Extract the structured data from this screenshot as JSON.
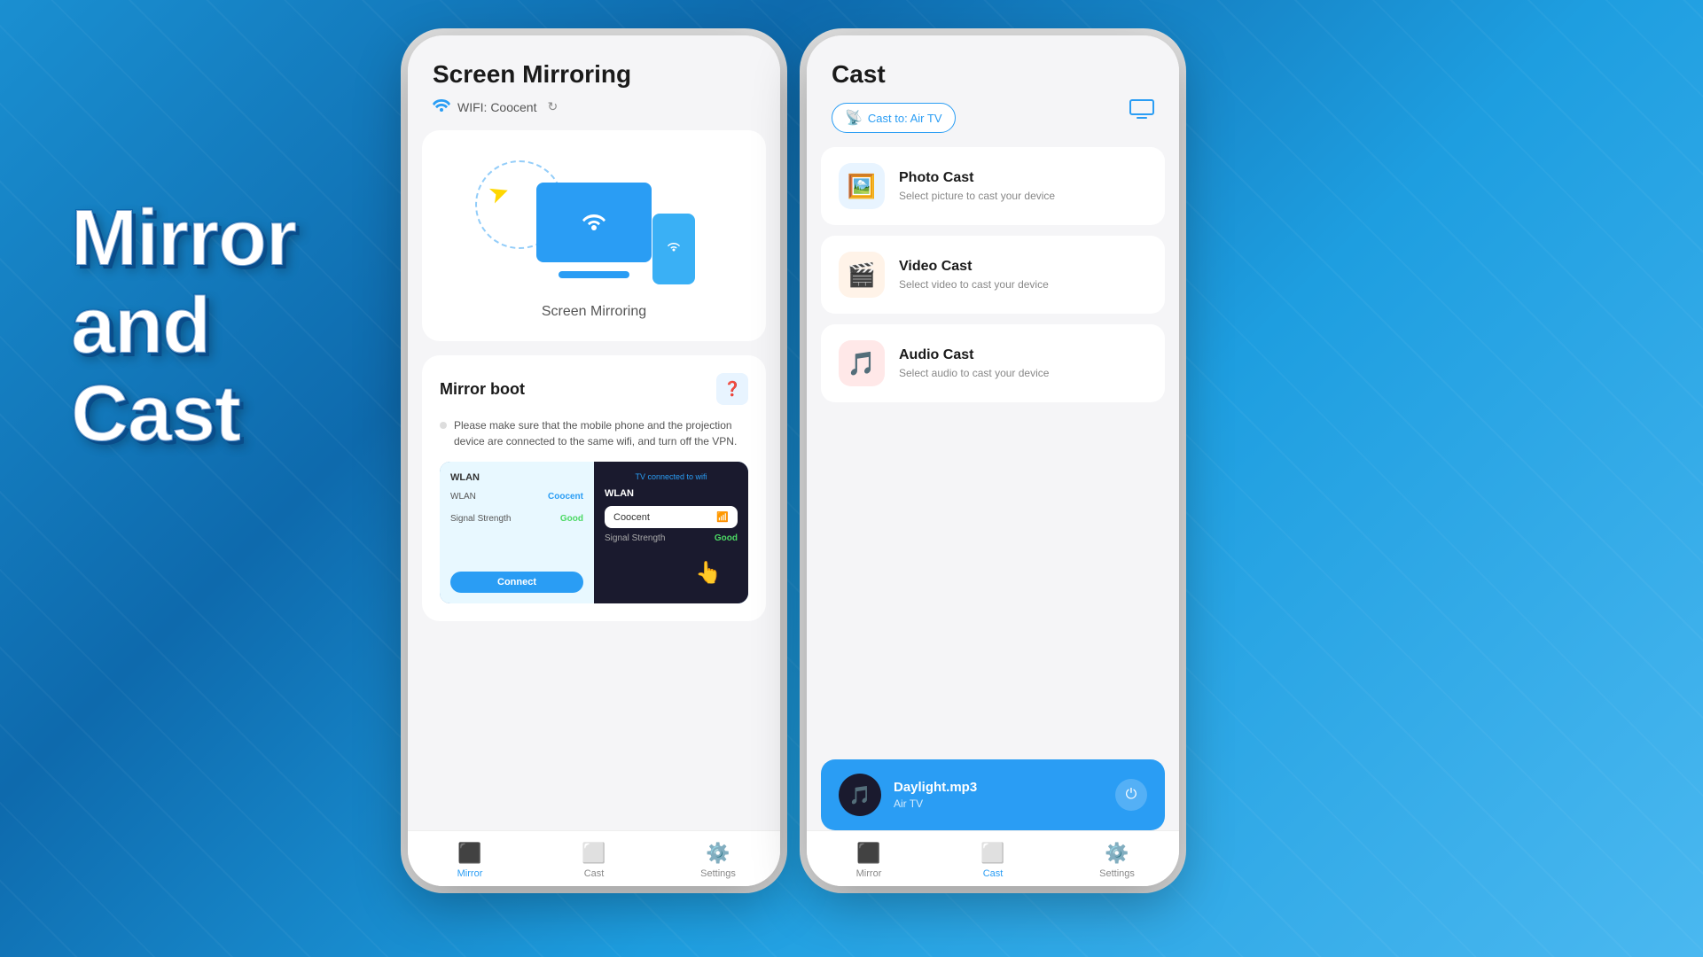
{
  "background": {
    "gradient_start": "#1a8fd1",
    "gradient_end": "#4ab8f0"
  },
  "hero": {
    "line1": "Mirror",
    "line2": "and",
    "line3": "Cast"
  },
  "mirror_screen": {
    "title": "Screen Mirroring",
    "wifi_label": "WIFI: Coocent",
    "mirror_label": "Screen Mirroring",
    "mirror_boot_title": "Mirror boot",
    "instruction": "Please make sure that the mobile phone and the projection device are connected to the same wifi, and turn off the VPN.",
    "tutorial_wlan": "WLAN",
    "tutorial_network": "Coocent",
    "tutorial_signal_label": "Signal Strength",
    "tutorial_signal_value": "Good",
    "tutorial_connect": "Connect",
    "tutorial_tv_connected": "TV connected to wifi",
    "nav_mirror_label": "Mirror",
    "nav_cast_label": "Cast",
    "nav_settings_label": "Settings"
  },
  "cast_screen": {
    "title": "Cast",
    "cast_to_label": "Cast to: Air TV",
    "photo_cast_title": "Photo Cast",
    "photo_cast_sub": "Select picture to cast your device",
    "video_cast_title": "Video Cast",
    "video_cast_sub": "Select video to cast your device",
    "audio_cast_title": "Audio Cast",
    "audio_cast_sub": "Select audio to cast your device",
    "now_playing_title": "Daylight.mp3",
    "now_playing_sub": "Air TV",
    "nav_mirror_label": "Mirror",
    "nav_cast_label": "Cast",
    "nav_settings_label": "Settings"
  }
}
